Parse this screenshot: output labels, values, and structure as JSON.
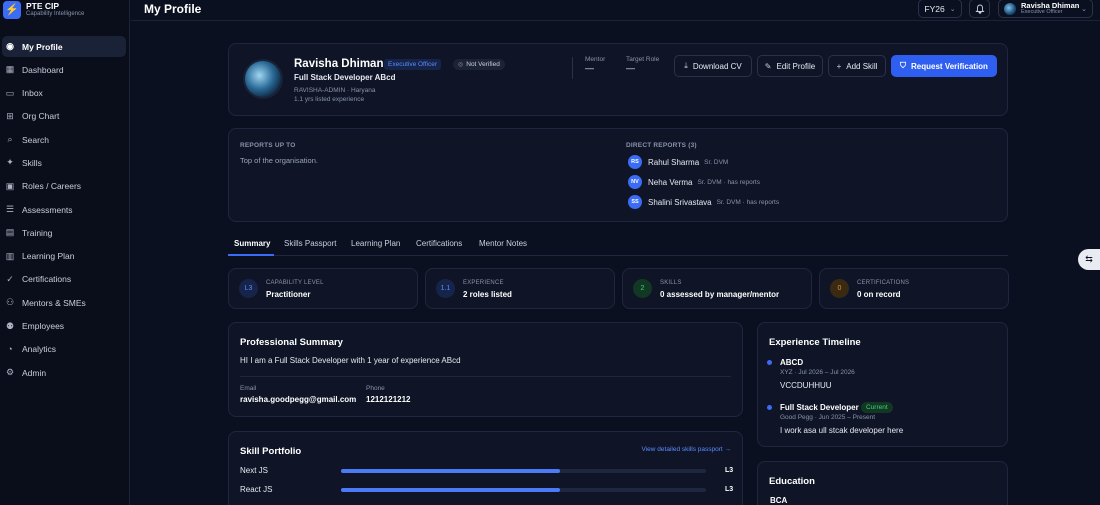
{
  "brand": {
    "title": "PTE CIP",
    "subtitle": "Capability Intelligence",
    "logo_icon": "bolt-icon"
  },
  "sidebar": {
    "items": [
      {
        "label": "My Profile",
        "icon": "user-circle-icon",
        "active": true
      },
      {
        "label": "Dashboard",
        "icon": "grid-icon"
      },
      {
        "label": "Inbox",
        "icon": "inbox-icon"
      },
      {
        "label": "Org Chart",
        "icon": "org-chart-icon"
      },
      {
        "label": "Search",
        "icon": "search-icon"
      },
      {
        "label": "Skills",
        "icon": "sparkle-icon"
      },
      {
        "label": "Roles / Careers",
        "icon": "briefcase-icon"
      },
      {
        "label": "Assessments",
        "icon": "clipboard-icon"
      },
      {
        "label": "Training",
        "icon": "book-icon"
      },
      {
        "label": "Learning Plan",
        "icon": "calendar-icon"
      },
      {
        "label": "Certifications",
        "icon": "badge-check-icon"
      },
      {
        "label": "Mentors & SMEs",
        "icon": "users-icon"
      },
      {
        "label": "Employees",
        "icon": "people-icon"
      },
      {
        "label": "Analytics",
        "icon": "chart-icon"
      },
      {
        "label": "Admin",
        "icon": "gear-icon"
      }
    ]
  },
  "header": {
    "title": "My Profile",
    "fy": "FY26",
    "user": {
      "name": "Ravisha Dhiman",
      "role": "Executive Officer"
    }
  },
  "profile": {
    "name": "Ravisha Dhiman",
    "role_badge": "Executive Officer",
    "verify_badge": "Not Verified",
    "title": "Full Stack Developer ABcd",
    "location": "RAVISHA-ADMIN · Haryana",
    "experience": "1.1 yrs listed experience",
    "mentor_label": "Mentor",
    "mentor_value": "—",
    "target_label": "Target Role",
    "target_value": "—",
    "buttons": {
      "download": "Download CV",
      "edit": "Edit Profile",
      "add_skill": "Add Skill",
      "verify": "Request Verification"
    }
  },
  "reports": {
    "up_label": "REPORTS UP TO",
    "up_text": "Top of the organisation.",
    "direct_label": "DIRECT REPORTS (3)",
    "direct": [
      {
        "initials": "RS",
        "name": "Rahul Sharma",
        "role": "Sr. DVM"
      },
      {
        "initials": "NV",
        "name": "Neha Verma",
        "role": "Sr. DVM · has reports"
      },
      {
        "initials": "SS",
        "name": "Shalini Srivastava",
        "role": "Sr. DVM · has reports"
      }
    ]
  },
  "tabs": [
    "Summary",
    "Skills Passport",
    "Learning Plan",
    "Certifications",
    "Mentor Notes"
  ],
  "stats": [
    {
      "badge": "L3",
      "label": "CAPABILITY LEVEL",
      "value": "Practitioner",
      "color": "#3b6cf6"
    },
    {
      "badge": "1.1",
      "label": "EXPERIENCE",
      "value": "2 roles listed",
      "color": "#3b6cf6"
    },
    {
      "badge": "2",
      "label": "SKILLS",
      "value": "0 assessed by manager/mentor",
      "color": "#3fd07a"
    },
    {
      "badge": "0",
      "label": "CERTIFICATIONS",
      "value": "0 on record",
      "color": "#e0902a"
    }
  ],
  "summary": {
    "title": "Professional Summary",
    "text": "HI I am a Full Stack Developer with 1 year of experience ABcd",
    "email_label": "Email",
    "email": "ravisha.goodpegg@gmail.com",
    "phone_label": "Phone",
    "phone": "1212121212"
  },
  "timeline": {
    "title": "Experience Timeline",
    "items": [
      {
        "title": "ABCD",
        "sub": "XYZ · Jul 2026 – Jul 2026",
        "desc": "VCCDUHHUU"
      },
      {
        "title": "Full Stack Developer",
        "badge": "Current",
        "sub": "Good Pegg · Jun 2025 – Present",
        "desc": "I work asa ull stcak developer here"
      }
    ]
  },
  "skills": {
    "title": "Skill Portfolio",
    "link": "View detailed skills passport →",
    "items": [
      {
        "name": "Next JS",
        "level": "L3",
        "fill": 0.6
      },
      {
        "name": "React JS",
        "level": "L3",
        "fill": 0.6
      }
    ]
  },
  "education": {
    "title": "Education",
    "items": [
      "BCA"
    ]
  }
}
